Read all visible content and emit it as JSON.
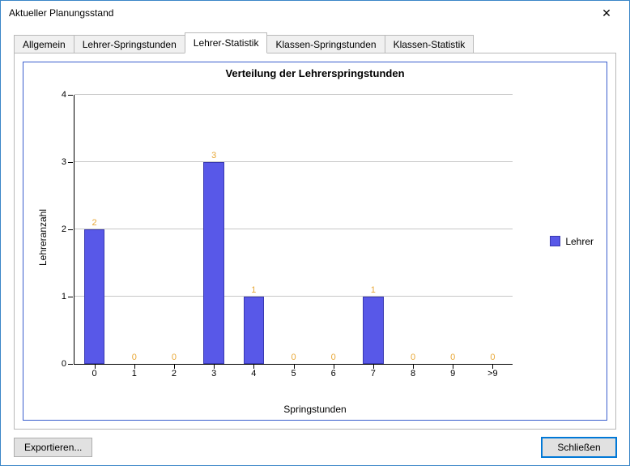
{
  "window": {
    "title": "Aktueller Planungsstand"
  },
  "tabs": {
    "items": [
      {
        "label": "Allgemein"
      },
      {
        "label": "Lehrer-Springstunden"
      },
      {
        "label": "Lehrer-Statistik"
      },
      {
        "label": "Klassen-Springstunden"
      },
      {
        "label": "Klassen-Statistik"
      }
    ],
    "active_index": 2
  },
  "buttons": {
    "export": "Exportieren...",
    "close": "Schließen"
  },
  "legend": {
    "label": "Lehrer"
  },
  "chart_data": {
    "type": "bar",
    "title": "Verteilung der Lehrerspringstunden",
    "xlabel": "Springstunden",
    "ylabel": "Lehreranzahl",
    "categories": [
      "0",
      "1",
      "2",
      "3",
      "4",
      "5",
      "6",
      "7",
      "8",
      "9",
      ">9"
    ],
    "values": [
      2,
      0,
      0,
      3,
      1,
      0,
      0,
      1,
      0,
      0,
      0
    ],
    "ylim": [
      0,
      4
    ],
    "y_ticks": [
      0,
      1,
      2,
      3,
      4
    ],
    "series": [
      {
        "name": "Lehrer",
        "values": [
          2,
          0,
          0,
          3,
          1,
          0,
          0,
          1,
          0,
          0,
          0
        ]
      }
    ],
    "bar_color": "#5858e8",
    "label_color": "#e8a838"
  }
}
